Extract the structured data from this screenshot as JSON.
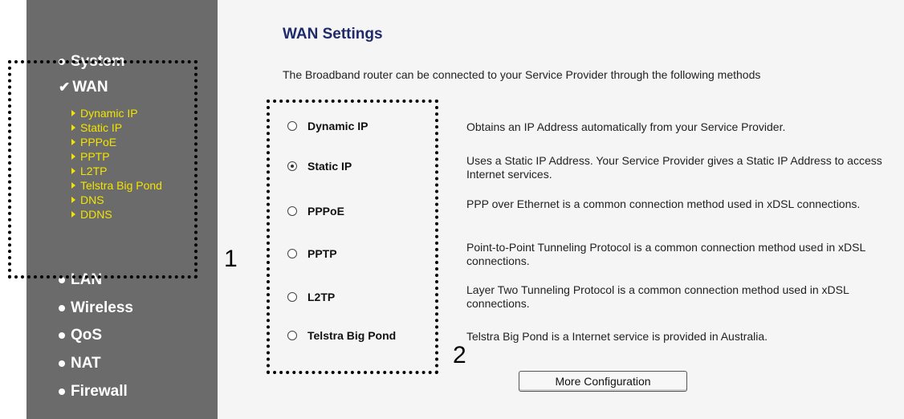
{
  "sidebar": {
    "menu": [
      {
        "label": "System",
        "mark": "dot"
      },
      {
        "label": "WAN",
        "mark": "check"
      },
      {
        "label": "LAN",
        "mark": "dot"
      },
      {
        "label": "Wireless",
        "mark": "dot"
      },
      {
        "label": "QoS",
        "mark": "dot"
      },
      {
        "label": "NAT",
        "mark": "dot"
      },
      {
        "label": "Firewall",
        "mark": "dot"
      }
    ],
    "wan_submenu": [
      "Dynamic IP",
      "Static IP",
      "PPPoE",
      "PPTP",
      "L2TP",
      "Telstra Big Pond",
      "DNS",
      "DDNS"
    ]
  },
  "main": {
    "title": "WAN Settings",
    "intro": "The Broadband router can be connected to your Service Provider through the following methods",
    "options": [
      {
        "label": "Dynamic IP",
        "selected": false,
        "description": "Obtains an IP Address automatically from your Service Provider."
      },
      {
        "label": "Static IP",
        "selected": true,
        "description": "Uses a Static IP Address. Your Service Provider gives a Static IP Address to access Internet services."
      },
      {
        "label": "PPPoE",
        "selected": false,
        "description": "PPP over Ethernet is a common connection method used in xDSL connections."
      },
      {
        "label": "PPTP",
        "selected": false,
        "description": "Point-to-Point Tunneling Protocol is a common connection method used in xDSL connections."
      },
      {
        "label": "L2TP",
        "selected": false,
        "description": "Layer Two Tunneling Protocol is a common connection method used in xDSL connections."
      },
      {
        "label": "Telstra Big Pond",
        "selected": false,
        "description": "Telstra Big Pond is a Internet service is provided in Australia."
      }
    ],
    "more_button": "More Configuration"
  },
  "annotations": {
    "marker_1": "1",
    "marker_2": "2"
  },
  "colors": {
    "sidebar_bg": "#6b6b6b",
    "submenu_text": "#f2e400",
    "title": "#1f2a6b",
    "content_bg": "#f5f5f5"
  }
}
